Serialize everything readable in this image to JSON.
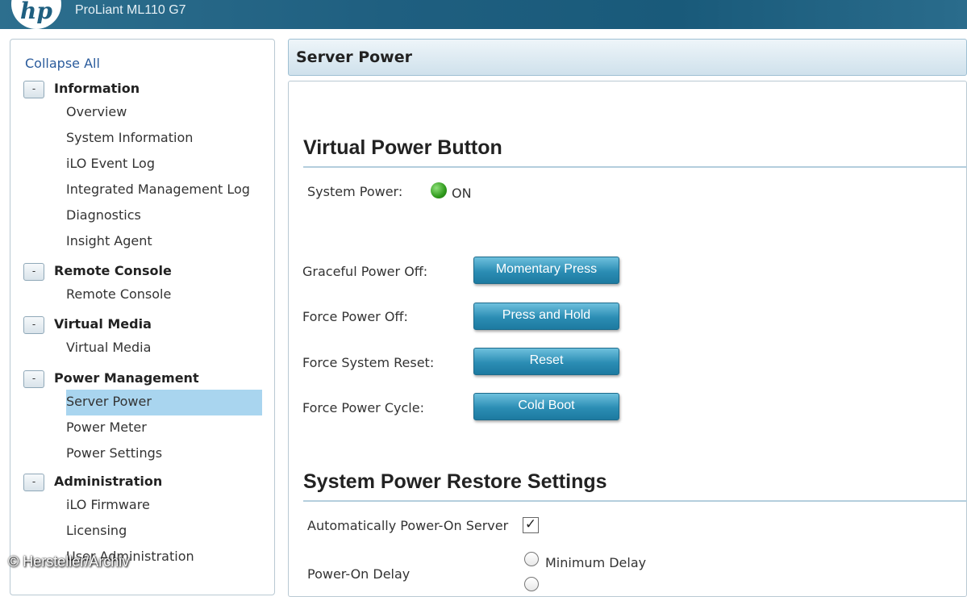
{
  "header": {
    "logo": "hp",
    "product": "ProLiant ML110 G7"
  },
  "sidebar": {
    "collapse_all": "Collapse All",
    "toggle_symbol": "-",
    "sections": [
      {
        "title": "Information",
        "items": [
          "Overview",
          "System Information",
          "iLO Event Log",
          "Integrated Management Log",
          "Diagnostics",
          "Insight Agent"
        ]
      },
      {
        "title": "Remote Console",
        "items": [
          "Remote Console"
        ]
      },
      {
        "title": "Virtual Media",
        "items": [
          "Virtual Media"
        ]
      },
      {
        "title": "Power Management",
        "items": [
          "Server Power",
          "Power Meter",
          "Power Settings"
        ]
      },
      {
        "title": "Administration",
        "items": [
          "iLO Firmware",
          "Licensing",
          "User Administration"
        ]
      }
    ],
    "active_item": "Server Power"
  },
  "main": {
    "title": "Server Power",
    "virtual_power": {
      "heading": "Virtual Power Button",
      "system_power_label": "System Power:",
      "system_power_status": "ON",
      "status_color": "#2f9a1c",
      "actions": [
        {
          "label": "Graceful Power Off:",
          "button": "Momentary Press"
        },
        {
          "label": "Force Power Off:",
          "button": "Press and Hold"
        },
        {
          "label": "Force System Reset:",
          "button": "Reset"
        },
        {
          "label": "Force Power Cycle:",
          "button": "Cold Boot"
        }
      ]
    },
    "restore": {
      "heading": "System Power Restore Settings",
      "auto_power_on_label": "Automatically Power-On Server",
      "auto_power_on_checked": true,
      "check_mark": "✓",
      "power_on_delay_label": "Power-On Delay",
      "delay_option_1": "Minimum Delay"
    }
  },
  "watermark": "© Hersteller/Archiv",
  "colors": {
    "accent": "#2b8db4",
    "header": "#1f5f80",
    "active_nav": "#a9d5ef"
  }
}
